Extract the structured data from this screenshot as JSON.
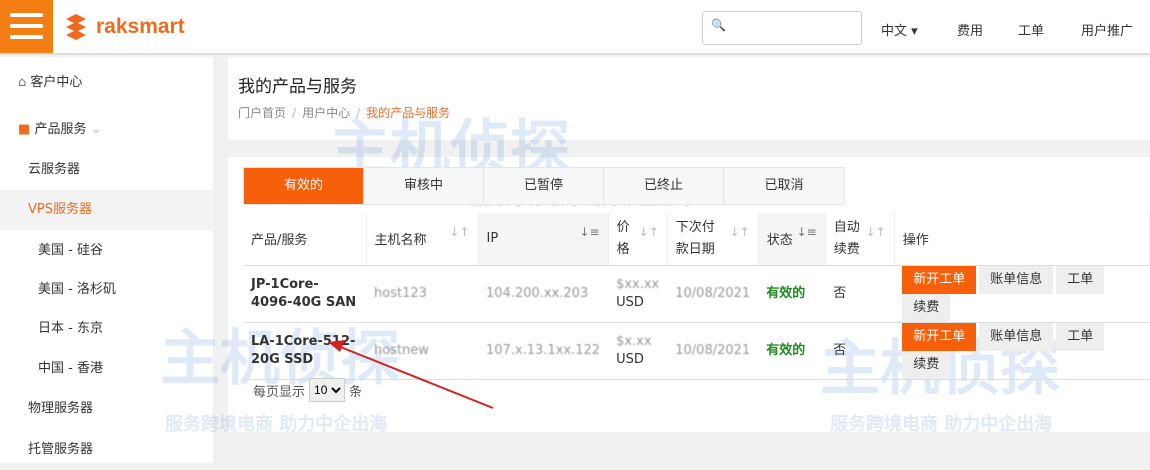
{
  "header": {
    "brand": "raksmart",
    "search_placeholder": "",
    "nav": [
      "中文 ▾",
      "费用",
      "工单",
      "用户推广"
    ]
  },
  "sidebar": {
    "items": [
      {
        "label": "客户中心"
      },
      {
        "label": "产品服务"
      },
      {
        "label": "云服务器"
      },
      {
        "label": "VPS服务器"
      },
      {
        "label": "美国 - 硅谷"
      },
      {
        "label": "美国 - 洛杉矶"
      },
      {
        "label": "日本 - 东京"
      },
      {
        "label": "中国 - 香港"
      },
      {
        "label": "物理服务器"
      },
      {
        "label": "托管服务器"
      }
    ]
  },
  "page": {
    "title": "我的产品与服务",
    "breadcrumb": [
      "门户首页",
      "用户中心",
      "我的产品与服务"
    ]
  },
  "tabs": [
    "有效的",
    "审核中",
    "已暂停",
    "已终止",
    "已取消"
  ],
  "table": {
    "headers": [
      "产品/服务",
      "主机名称",
      "IP",
      "价格",
      "下次付款日期",
      "状态",
      "自动续费",
      "操作"
    ],
    "rows": [
      {
        "product": "JP-1Core-4096-40G SAN",
        "host": "host123",
        "ip": "104.200.xx.203",
        "price": "$xx.xx",
        "currency": "USD",
        "date": "10/08/2021",
        "status": "有效的",
        "auto": "否"
      },
      {
        "product": "LA-1Core-512-20G SSD",
        "host": "hostnew",
        "ip": "107.x.13.1xx.122",
        "price": "$x.xx",
        "currency": "USD",
        "date": "10/08/2021",
        "status": "有效的",
        "auto": "否"
      }
    ],
    "actions": [
      "新开工单",
      "账单信息",
      "工单",
      "续费"
    ]
  },
  "pagination": {
    "prefix": "每页显示",
    "value": "10",
    "suffix": "条"
  },
  "watermark": {
    "title": "主机侦探",
    "slogan": "服务跨境电商 助力中企出海"
  }
}
